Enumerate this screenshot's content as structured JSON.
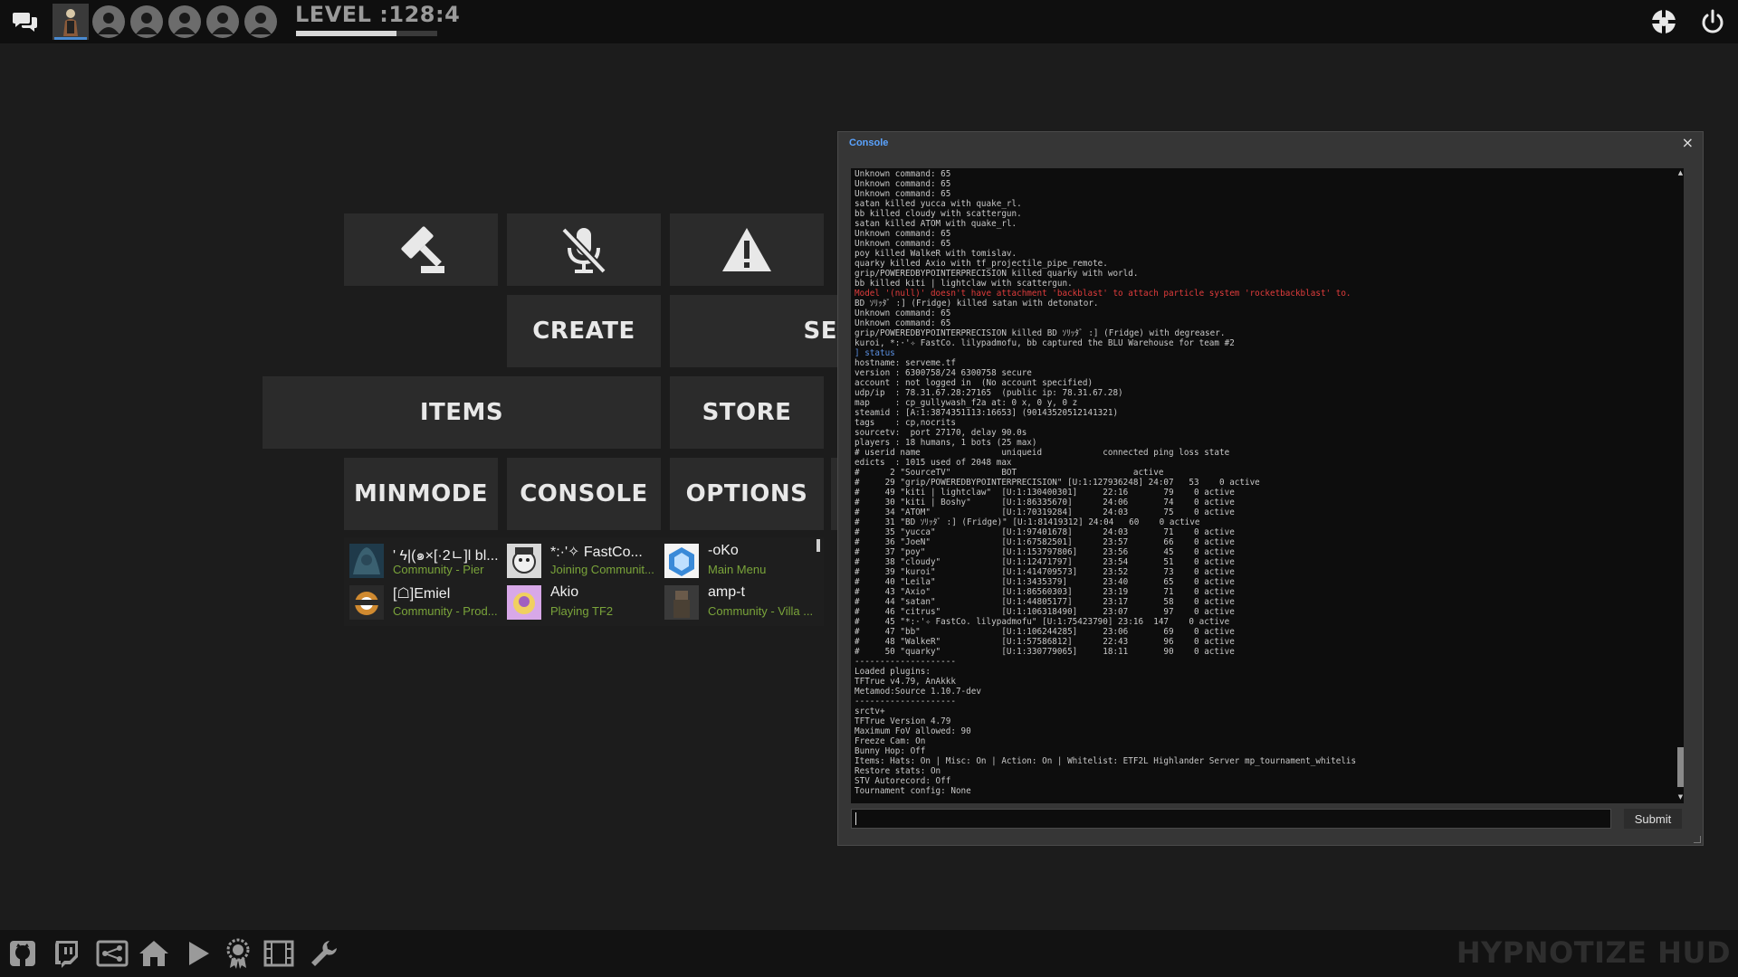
{
  "topbar": {
    "level_text": "LEVEL :128:4",
    "level_progress": 0.71,
    "icons": [
      "chat-icon",
      "character-portrait",
      "user-icon",
      "user-icon",
      "user-icon",
      "user-icon",
      "user-icon",
      "tf2-logo-icon",
      "power-icon"
    ]
  },
  "menu": {
    "create": "CREATE",
    "server_partial": "SE",
    "items": "ITEMS",
    "store": "STORE",
    "minmode": "MINMODE",
    "console": "CONSOLE",
    "options": "OPTIONS",
    "icons": [
      "gavel-icon",
      "mic-muted-icon",
      "warning-icon"
    ]
  },
  "friends": [
    {
      "name": "' ϟ|(๑×[·2ㄴ]l bl...",
      "status": "Community - Pier"
    },
    {
      "name": "*:·'✧ FastCo...",
      "status": "Joining Communit..."
    },
    {
      "name": "-oKo",
      "status": "Main Menu"
    },
    {
      "name": "[☖]Emiel",
      "status": "Community - Prod..."
    },
    {
      "name": "Akio",
      "status": "Playing TF2"
    },
    {
      "name": "amp-t",
      "status": "Community - Villa ..."
    }
  ],
  "console": {
    "title": "Console",
    "close": "×",
    "submit": "Submit",
    "lines": [
      {
        "t": "Unknown command: 65"
      },
      {
        "t": "Unknown command: 65"
      },
      {
        "t": "Unknown command: 65"
      },
      {
        "t": "satan killed yucca with quake_rl."
      },
      {
        "t": "bb killed cloudy with scattergun."
      },
      {
        "t": "satan killed ATOM with quake_rl."
      },
      {
        "t": "Unknown command: 65"
      },
      {
        "t": "Unknown command: 65"
      },
      {
        "t": "poy killed WalkeR with tomislav."
      },
      {
        "t": "quarky killed Axio with tf_projectile_pipe_remote."
      },
      {
        "t": "grip/POWEREDBYPOINTERPRECISION killed quarky with world."
      },
      {
        "t": "bb killed kiti | lightclaw with scattergun."
      },
      {
        "t": "Model '(null)' doesn't have attachment 'backblast' to attach particle system 'rocketbackblast' to.",
        "c": "red"
      },
      {
        "t": "BD ｿﾘｯﾀﾞ :] (Fridge) killed satan with detonator."
      },
      {
        "t": "Unknown command: 65"
      },
      {
        "t": "Unknown command: 65"
      },
      {
        "t": "grip/POWEREDBYPOINTERPRECISION killed BD ｿﾘｯﾀﾞ :] (Fridge) with degreaser."
      },
      {
        "t": "kuroi, *:·'✧ FastCo. lilypadmofu, bb captured the BLU Warehouse for team #2"
      },
      {
        "t": "] status",
        "c": "blue"
      },
      {
        "t": "hostname: serveme.tf"
      },
      {
        "t": "version : 6300758/24 6300758 secure"
      },
      {
        "t": "account : not logged in  (No account specified)"
      },
      {
        "t": "udp/ip  : 78.31.67.28:27165  (public ip: 78.31.67.28)"
      },
      {
        "t": "map     : cp_gullywash_f2a at: 0 x, 0 y, 0 z"
      },
      {
        "t": "steamid : [A:1:3874351113:16653] (90143520512141321)"
      },
      {
        "t": "tags    : cp,nocrits"
      },
      {
        "t": "sourcetv:  port 27170, delay 90.0s"
      },
      {
        "t": "players : 18 humans, 1 bots (25 max)"
      },
      {
        "t": "# userid name                uniqueid            connected ping loss state"
      },
      {
        "t": "edicts  : 1015 used of 2048 max"
      },
      {
        "t": "#      2 \"SourceTV\"          BOT                       active"
      },
      {
        "t": "#     29 \"grip/POWEREDBYPOINTERPRECISION\" [U:1:127936248] 24:07   53    0 active"
      },
      {
        "t": "#     49 \"kiti | lightclaw\"  [U:1:130400301]     22:16       79    0 active"
      },
      {
        "t": "#     30 \"kiti | Boshy\"      [U:1:86335670]      24:06       74    0 active"
      },
      {
        "t": "#     34 \"ATOM\"              [U:1:70319284]      24:03       75    0 active"
      },
      {
        "t": "#     31 \"BD ｿﾘｯﾀﾞ :] (Fridge)\" [U:1:81419312] 24:04   60    0 active"
      },
      {
        "t": "#     35 \"yucca\"             [U:1:97401678]      24:03       71    0 active"
      },
      {
        "t": "#     36 \"JoeN\"              [U:1:67582501]      23:57       66    0 active"
      },
      {
        "t": "#     37 \"poy\"               [U:1:153797806]     23:56       45    0 active"
      },
      {
        "t": "#     38 \"cloudy\"            [U:1:12471797]      23:54       51    0 active"
      },
      {
        "t": "#     39 \"kuroi\"             [U:1:414709573]     23:52       73    0 active"
      },
      {
        "t": "#     40 \"Leila\"             [U:1:3435379]       23:40       65    0 active"
      },
      {
        "t": "#     43 \"Axio\"              [U:1:86560303]      23:19       71    0 active"
      },
      {
        "t": "#     44 \"satan\"             [U:1:44805177]      23:17       58    0 active"
      },
      {
        "t": "#     46 \"citrus\"            [U:1:106318490]     23:07       97    0 active"
      },
      {
        "t": "#     45 \"*:·'✧ FastCo. lilypadmofu\" [U:1:75423790] 23:16  147    0 active"
      },
      {
        "t": "#     47 \"bb\"                [U:1:106244285]     23:06       69    0 active"
      },
      {
        "t": "#     48 \"WalkeR\"            [U:1:57586812]      22:43       96    0 active"
      },
      {
        "t": "#     50 \"quarky\"            [U:1:330779065]     18:11       90    0 active"
      },
      {
        "t": "--------------------"
      },
      {
        "t": "Loaded plugins:"
      },
      {
        "t": "TFTrue v4.79, AnAkkk"
      },
      {
        "t": "Metamod:Source 1.10.7-dev"
      },
      {
        "t": "--------------------"
      },
      {
        "t": "srctv+"
      },
      {
        "t": "TFTrue Version 4.79"
      },
      {
        "t": "Maximum FoV allowed: 90"
      },
      {
        "t": "Freeze Cam: On"
      },
      {
        "t": "Bunny Hop: Off"
      },
      {
        "t": "Items: Hats: On | Misc: On | Action: On | Whitelist: ETF2L Highlander Server mp_tournament_whitelis"
      },
      {
        "t": "Restore stats: On"
      },
      {
        "t": "STV Autorecord: Off"
      },
      {
        "t": "Tournament config: None"
      }
    ]
  },
  "bottombar": {
    "brand": "HYPNOTIZE HUD",
    "icons": [
      "github-icon",
      "twitch-icon",
      "network-icon",
      "home-icon",
      "play-icon",
      "achievement-icon",
      "film-icon",
      "wrench-icon"
    ]
  }
}
